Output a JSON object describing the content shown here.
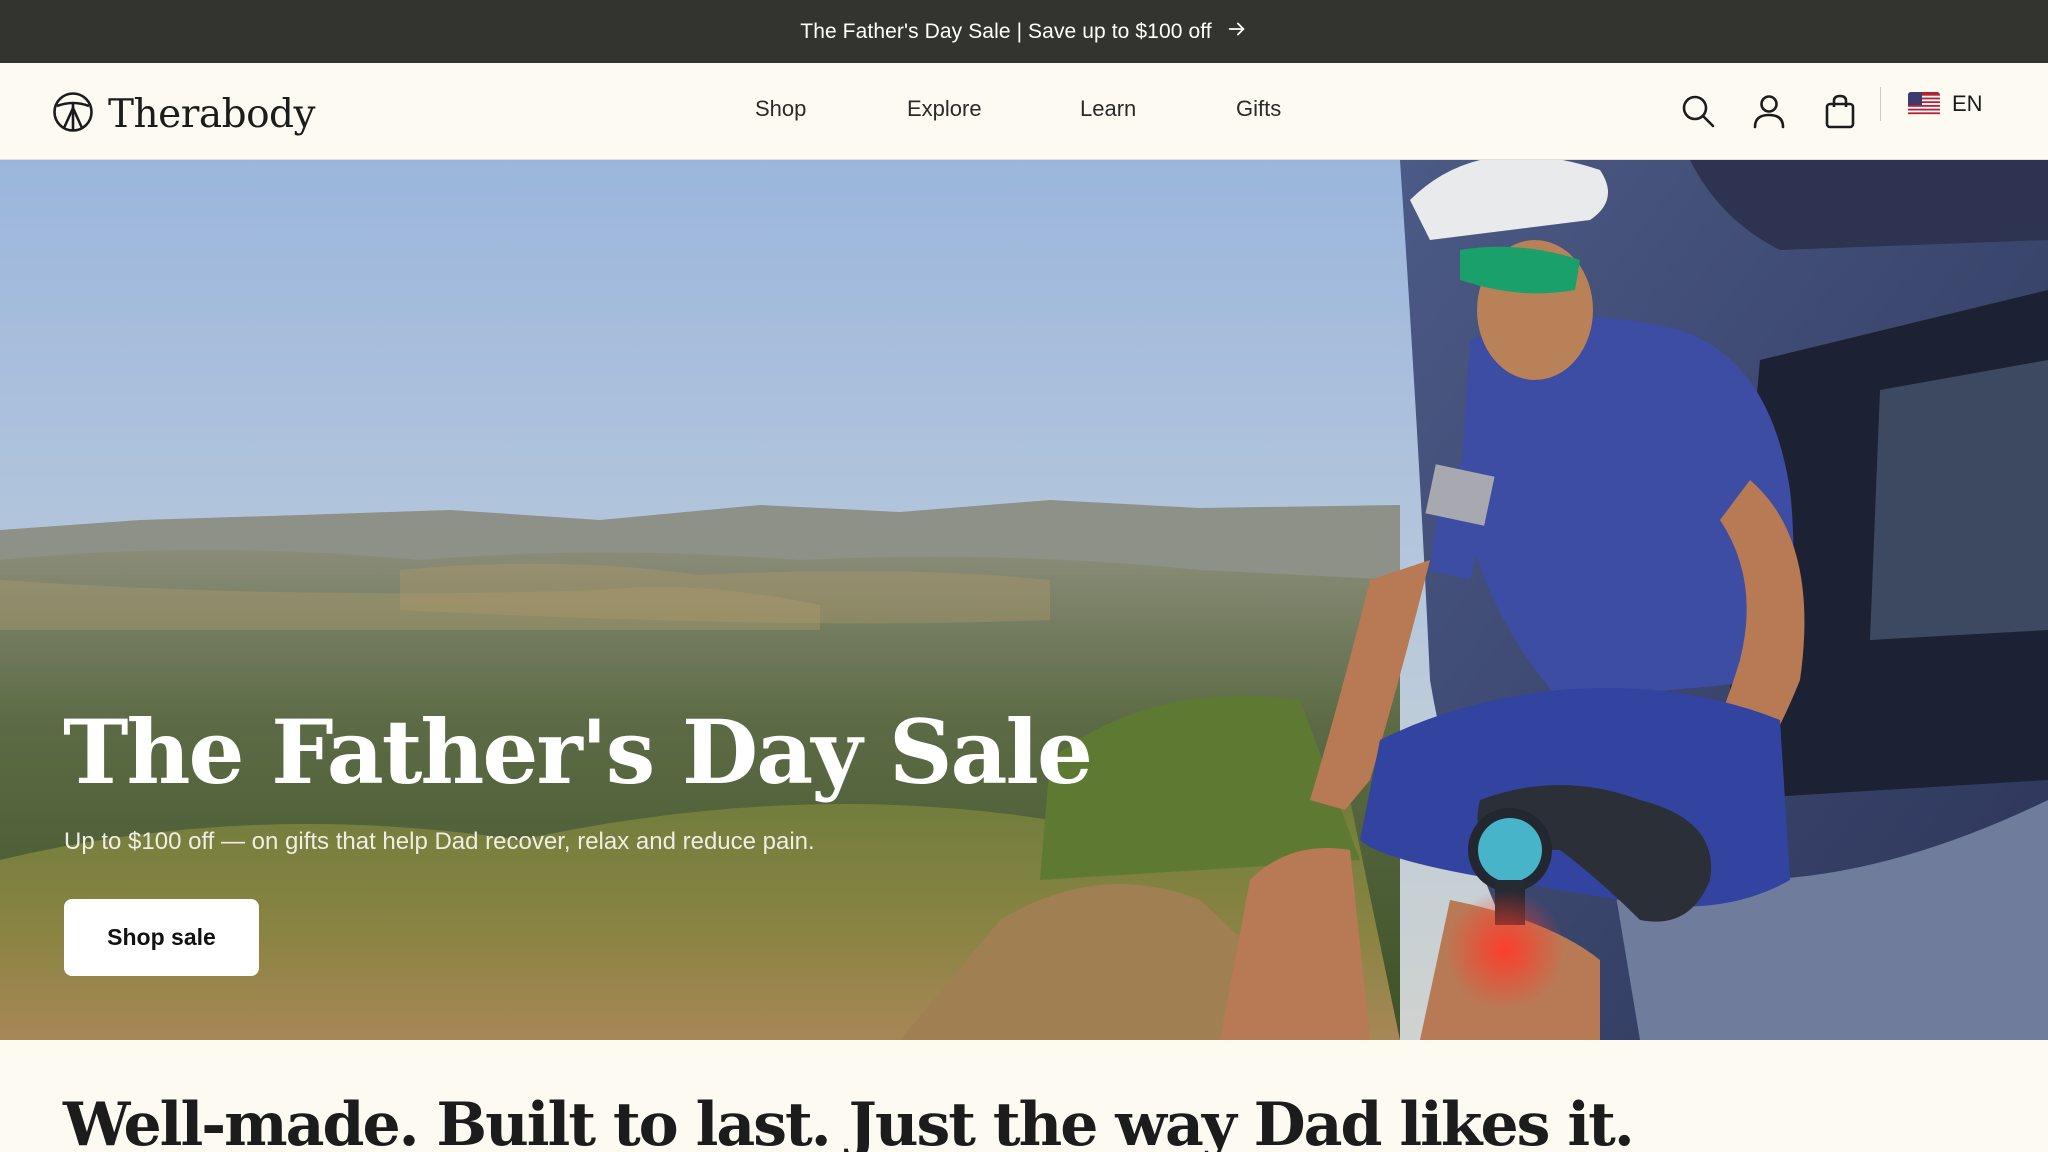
{
  "announcement": {
    "text": "The Father's Day Sale | Save up to $100 off",
    "icon": "arrow-right-icon"
  },
  "header": {
    "brand": "Therabody",
    "nav": [
      {
        "label": "Shop"
      },
      {
        "label": "Explore"
      },
      {
        "label": "Learn"
      },
      {
        "label": "Gifts"
      }
    ],
    "icons": [
      "search-icon",
      "account-icon",
      "cart-icon"
    ],
    "language": {
      "code": "EN",
      "flag": "us-flag-icon"
    }
  },
  "hero": {
    "title": "The Father's Day Sale",
    "subtitle": "Up to $100 off — on gifts that help Dad recover, relax and reduce pain.",
    "cta_label": "Shop sale"
  },
  "section": {
    "title": "Well-made. Built to last. Just the way Dad likes it."
  },
  "colors": {
    "announcement_bg": "#33342f",
    "page_bg": "#fdfbf1",
    "cta_bg": "#ffffff",
    "jersey": "#3d4da3"
  }
}
